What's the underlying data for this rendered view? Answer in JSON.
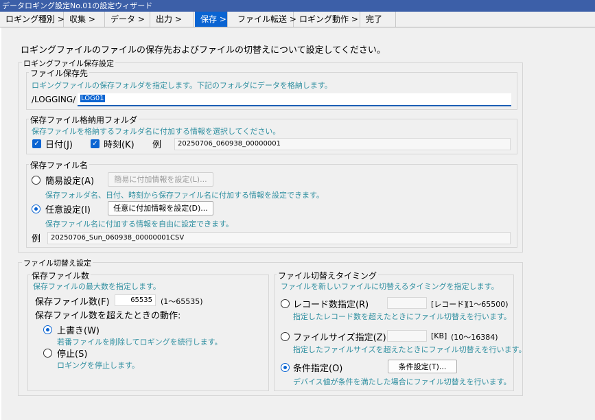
{
  "window": {
    "title": "データロギング設定No.01の設定ウィザード"
  },
  "tabs": [
    {
      "label": "ロギング種別 >"
    },
    {
      "label": "収集 >"
    },
    {
      "label": "データ >"
    },
    {
      "label": "出力 >"
    },
    {
      "label": "保存 >"
    },
    {
      "label": "ファイル転送 >"
    },
    {
      "label": "ロギング動作 >"
    },
    {
      "label": "完了"
    }
  ],
  "main": {
    "heading": "ロギングファイルのファイルの保存先およびファイルの切替えについて設定してください。"
  },
  "save_settings": {
    "group_label": "ロギングファイル保存設定",
    "dest": {
      "label": "ファイル保存先",
      "hint": "ロギングファイルの保存フォルダを指定します。下記のフォルダにデータを格納します。",
      "prefix": "/LOGGING/",
      "folder_value": "LOG01"
    },
    "folder_name": {
      "label": "保存ファイル格納用フォルダ",
      "hint": "保存ファイルを格納するフォルダ名に付加する情報を選択してください。",
      "date_label": "日付(J)",
      "time_label": "時刻(K)",
      "example_label": "例",
      "example_value": "20250706_060938_00000001"
    },
    "file_name": {
      "label": "保存ファイル名",
      "simple_label": "簡易設定(A)",
      "simple_button": "簡易に付加情報を設定(L)...",
      "simple_hint": "保存フォルダ名、日付、時刻から保存ファイル名に付加する情報を設定できます。",
      "custom_label": "任意設定(I)",
      "custom_button": "任意に付加情報を設定(D)...",
      "custom_hint": "保存ファイル名に付加する情報を自由に設定できます。",
      "example_label": "例",
      "example_value": "20250706_Sun_060938_00000001CSV"
    }
  },
  "switch_settings": {
    "group_label": "ファイル切替え設定",
    "count": {
      "label": "保存ファイル数",
      "hint": "保存ファイルの最大数を指定します。",
      "count_label": "保存ファイル数(F)",
      "count_value": "65535",
      "count_range": "(1〜65535)",
      "exceed_label": "保存ファイル数を超えたときの動作:",
      "overwrite_label": "上書き(W)",
      "overwrite_hint": "若番ファイルを削除してロギングを続行します。",
      "stop_label": "停止(S)",
      "stop_hint": "ロギングを停止します。"
    },
    "timing": {
      "label": "ファイル切替えタイミング",
      "hint": "ファイルを新しいファイルに切替えるタイミングを指定します。",
      "records_label": "レコード数指定(R)",
      "records_unit": "[レコード]",
      "records_range": "(1〜65500)",
      "records_hint": "指定したレコード数を超えたときにファイル切替えを行います。",
      "size_label": "ファイルサイズ指定(Z)",
      "size_unit": "[KB]",
      "size_range": "(10〜16384)",
      "size_hint": "指定したファイルサイズを超えたときにファイル切替えを行います。",
      "condition_label": "条件指定(O)",
      "condition_button": "条件設定(T)...",
      "condition_hint": "デバイス値が条件を満たした場合にファイル切替えを行います。"
    }
  },
  "colors": {
    "accent": "#0a64d2",
    "hint": "#2f8fa0",
    "titlebar": "#3c5fa8"
  },
  "icons": {
    "check": "checkmark-icon",
    "radio": "radio-icon"
  }
}
